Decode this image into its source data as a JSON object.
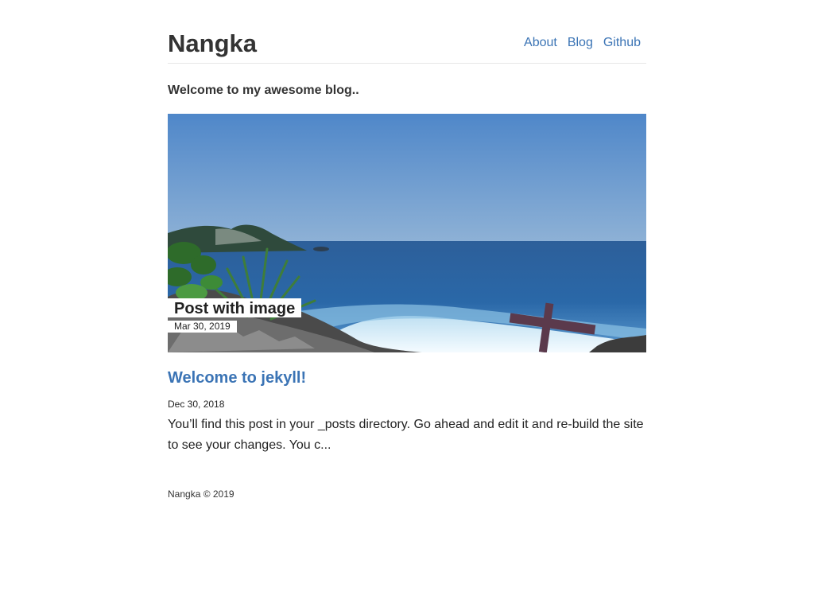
{
  "site": {
    "title": "Nangka"
  },
  "nav": {
    "items": [
      {
        "label": "About"
      },
      {
        "label": "Blog"
      },
      {
        "label": "Github"
      }
    ]
  },
  "intro": {
    "text": "Welcome to my awesome blog.."
  },
  "featured_post": {
    "title": "Post with image",
    "date": "Mar 30, 2019",
    "image": "seaside-cliff-photo"
  },
  "posts": [
    {
      "title": "Welcome to jekyll!",
      "date": "Dec 30, 2018",
      "excerpt": "You’ll find this post in your _posts directory. Go ahead and edit it and re-build the site to see your changes. You c..."
    }
  ],
  "footer": {
    "text": "Nangka © 2019"
  },
  "colors": {
    "link": "#3b74b5",
    "text": "#222222",
    "divider": "#e6e6e6"
  }
}
